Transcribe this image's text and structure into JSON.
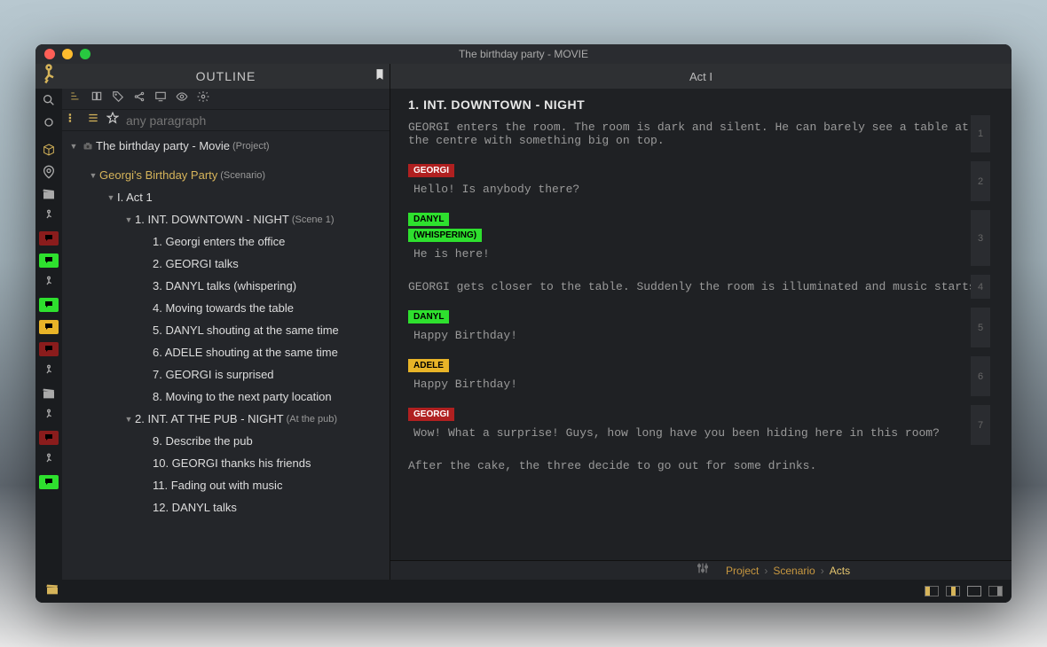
{
  "window_title": "The birthday party - MOVIE",
  "outline_header": "OUTLINE",
  "search": {
    "placeholder": "any paragraph"
  },
  "tree": {
    "project": {
      "label": "The birthday party - Movie",
      "suffix": "(Project)"
    },
    "scenario": {
      "label": "Georgi's Birthday Party",
      "suffix": "(Scenario)"
    },
    "act1": {
      "label": "I. Act 1"
    },
    "scene1": {
      "label": "1. INT.  DOWNTOWN - NIGHT",
      "suffix": "(Scene 1)"
    },
    "beats1": [
      "1. Georgi enters the office",
      "2. GEORGI talks",
      "3. DANYL talks (whispering)",
      "4. Moving towards the table",
      "5. DANYL shouting at the same time",
      "6. ADELE shouting at the same time",
      "7. GEORGI is surprised",
      "8. Moving to the next party location"
    ],
    "scene2": {
      "label": "2. INT.  AT THE PUB - NIGHT",
      "suffix": "(At the pub)"
    },
    "beats2": [
      "9. Describe the pub",
      "10. GEORGI thanks his friends",
      "11. Fading out with music",
      "12. DANYL talks"
    ]
  },
  "script": {
    "act": "Act I",
    "heading": "1. INT.  DOWNTOWN - NIGHT",
    "blocks": [
      {
        "n": "1",
        "type": "action",
        "text": "GEORGI enters the room. The room is dark and silent. He can barely see a table at the centre with something big on top."
      },
      {
        "n": "2",
        "type": "dialogue",
        "char": "GEORGI",
        "color": "red",
        "text": "Hello! Is anybody there?"
      },
      {
        "n": "3",
        "type": "dialogue",
        "char": "DANYL",
        "sub": "(WHISPERING)",
        "color": "green",
        "text": "He is here!"
      },
      {
        "n": "4",
        "type": "action",
        "text": "GEORGI gets closer to the table. Suddenly the room is illuminated and music starts"
      },
      {
        "n": "5",
        "type": "dialogue",
        "char": "DANYL",
        "color": "green",
        "text": "Happy Birthday!"
      },
      {
        "n": "6",
        "type": "dialogue",
        "char": "ADELE",
        "color": "yellow",
        "text": "Happy Birthday!"
      },
      {
        "n": "7",
        "type": "dialogue",
        "char": "GEORGI",
        "color": "red",
        "text": "Wow! What a surprise! Guys, how long have you been hiding here in this room?"
      },
      {
        "n": "",
        "type": "action",
        "text": "After the cake, the three decide to go out for some drinks."
      }
    ]
  },
  "breadcrumb": {
    "a": "Project",
    "b": "Scenario",
    "c": "Acts"
  },
  "rail_colors": {
    "red": "#8a1c1c",
    "green": "#2ee02e",
    "yellow": "#e8b428"
  }
}
